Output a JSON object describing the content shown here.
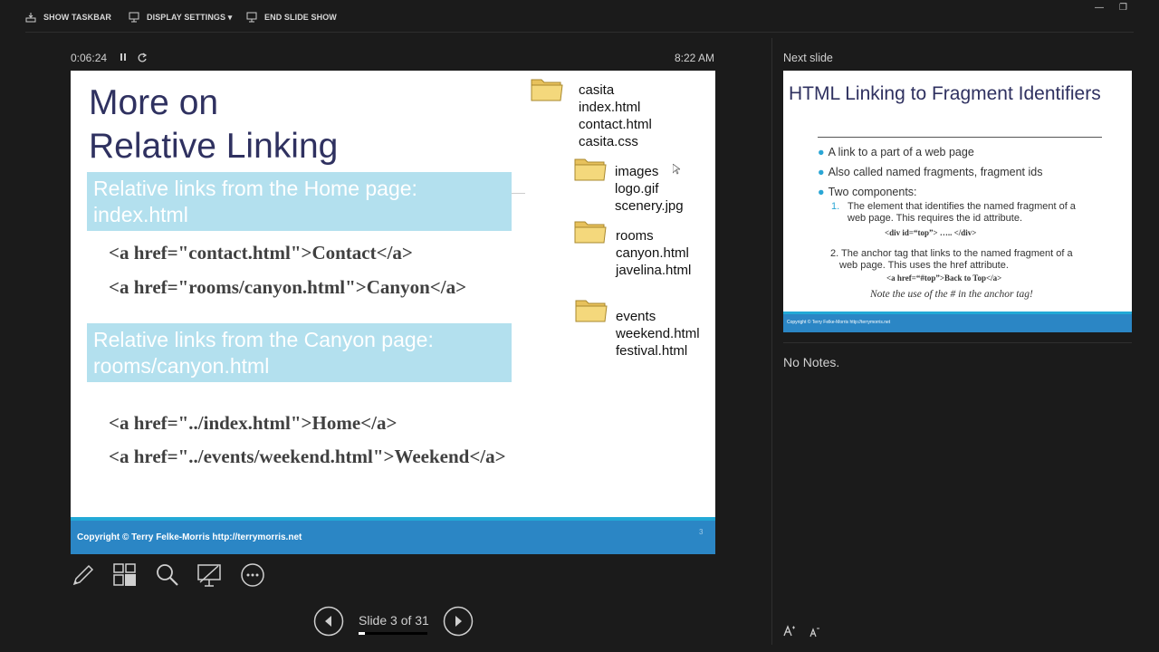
{
  "toolbar": {
    "show_taskbar": "SHOW TASKBAR",
    "display_settings": "DISPLAY SETTINGS ▾",
    "end_slide_show": "END SLIDE SHOW"
  },
  "timer": {
    "elapsed": "0:06:24",
    "clock": "8:22 AM"
  },
  "slide": {
    "title_line1": "More on",
    "title_line2": "Relative Linking",
    "band1_line1": "Relative links from the Home page:",
    "band1_line2": "index.html",
    "code1": "<a href=\"contact.html\">Contact</a>",
    "code2": "<a href=\"rooms/canyon.html\">Canyon</a>",
    "band2_line1": "Relative links from the Canyon page:",
    "band2_line2": "rooms/canyon.html",
    "code3": "<a href=\"../index.html\">Home</a>",
    "code4": "<a href=\"../events/weekend.html\">Weekend</a>",
    "tree_root": [
      "casita",
      "index.html",
      "contact.html",
      "casita.css"
    ],
    "tree_images": [
      "images",
      "logo.gif",
      "scenery.jpg"
    ],
    "tree_rooms": [
      "rooms",
      "canyon.html",
      "javelina.html"
    ],
    "tree_events": [
      "events",
      "weekend.html",
      "festival.html"
    ],
    "footer": "Copyright © Terry Felke-Morris http://terrymorris.net",
    "page_number": "3"
  },
  "next_panel": {
    "label": "Next slide",
    "title": "HTML Linking to Fragment Identifiers",
    "bullets": [
      "A link to a part of a web page",
      "Also called named fragments, fragment ids",
      "Two components:"
    ],
    "sub1_num": "1.",
    "sub1_line1": "The element that identifies the named fragment of a",
    "sub1_line2": "web page. This requires the id attribute.",
    "sub1_code": "<div id=“top”> ….. </div>",
    "sub2_line1": "2. The anchor tag that links to the named fragment of a",
    "sub2_line2": "web page. This uses the href attribute.",
    "sub2_code": "<a href=“#top”>Back to Top</a>",
    "note": "Note the use of the # in the anchor tag!",
    "footer": "Copyright © Terry Felke-Morris http://terrymorris.net",
    "notes_text": "No Notes."
  },
  "navigation": {
    "slide_counter": "Slide 3 of 31",
    "progress": 0.097
  },
  "icons": [
    "taskbar-icon",
    "display-icon",
    "end-show-icon",
    "pause-icon",
    "restart-icon",
    "pen-icon",
    "slides-grid-icon",
    "zoom-icon",
    "black-screen-icon",
    "more-options-icon",
    "previous-icon",
    "next-icon",
    "font-larger-icon",
    "font-smaller-icon",
    "folder-icon"
  ],
  "colors": {
    "background": "#1b1b1b",
    "slide_title": "#2f3160",
    "band": "#b3e0ee",
    "footer": "#2b86c5",
    "accent": "#22a9d6"
  }
}
